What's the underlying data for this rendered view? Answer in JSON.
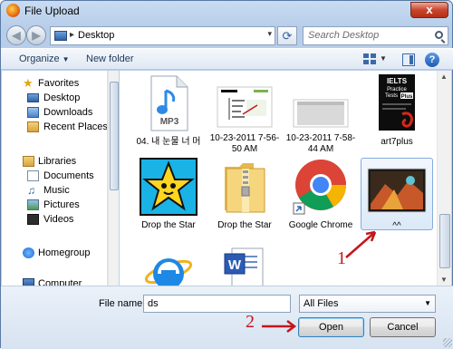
{
  "window": {
    "title": "File Upload",
    "close_glyph": "x"
  },
  "address_bar": {
    "location": "Desktop",
    "chevron": "▸",
    "dropdown_glyph": "▾"
  },
  "search": {
    "placeholder": "Search Desktop"
  },
  "toolbar": {
    "organize_label": "Organize",
    "new_folder_label": "New folder"
  },
  "sidebar": {
    "favorites": {
      "label": "Favorites",
      "items": [
        "Desktop",
        "Downloads",
        "Recent Places"
      ]
    },
    "libraries": {
      "label": "Libraries",
      "items": [
        "Documents",
        "Music",
        "Pictures",
        "Videos"
      ]
    },
    "homegroup": {
      "label": "Homegroup"
    },
    "computer": {
      "label": "Computer"
    }
  },
  "files": [
    {
      "label": "04. 내 눈물 너 머",
      "icon": "mp3-icon",
      "badge": "MP3"
    },
    {
      "label": "10-23-2011 7-56-50 AM",
      "icon": "screenshot-thumbnail"
    },
    {
      "label": "10-23-2011 7-58-44 AM",
      "icon": "screenshot-thumbnail"
    },
    {
      "label": "art7plus",
      "icon": "pdf-book-thumbnail",
      "cover_lines": [
        "IELTS",
        "Practice",
        "Tests",
        "Plus"
      ]
    },
    {
      "label": "Drop the Star",
      "icon": "star-game-icon"
    },
    {
      "label": "Drop the Star",
      "icon": "zip-folder-icon"
    },
    {
      "label": "Google Chrome",
      "icon": "chrome-icon"
    },
    {
      "label": "^^",
      "icon": "photo-thumbnail",
      "selected": true
    },
    {
      "label": "",
      "icon": "internet-explorer-icon"
    },
    {
      "label": "",
      "icon": "word-document-icon"
    }
  ],
  "bottom": {
    "file_name_label": "File name:",
    "file_name_value": "ds",
    "file_type_value": "All Files",
    "open_label": "Open",
    "cancel_label": "Cancel"
  },
  "annotations": {
    "one": "1",
    "two": "2"
  },
  "colors": {
    "accent": "#3c7fb1",
    "annotation_red": "#c4161c",
    "selection": "#dbe9f8"
  }
}
